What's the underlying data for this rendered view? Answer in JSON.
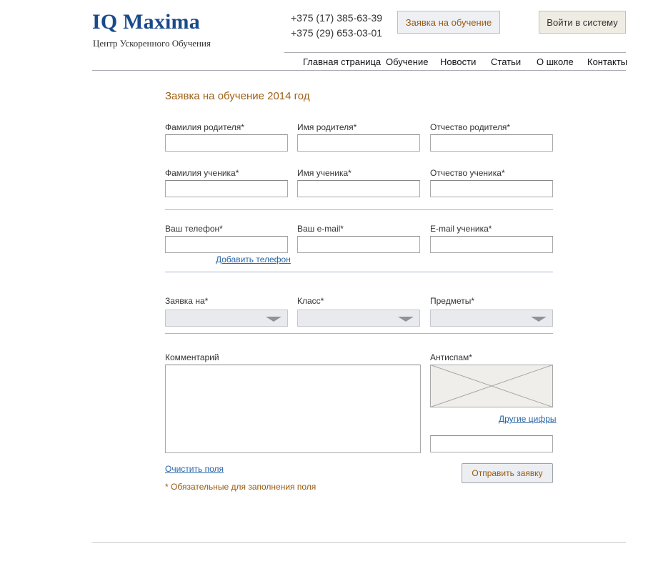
{
  "header": {
    "logo_text": "IQ Maxima",
    "tagline": "Центр Ускоренного Обучения",
    "phones": [
      "+375 (17) 385-63-39",
      "+375 (29) 653-03-01"
    ],
    "apply_button_label": "Заявка на обучение",
    "login_button_label": "Войти в систему"
  },
  "nav": {
    "items": [
      "Главная страница",
      "Обучение",
      "Новости",
      "Статьи",
      "О школе",
      "Контакты"
    ]
  },
  "form": {
    "title": "Заявка на обучение 2014 год",
    "parent_last_name": {
      "label": "Фамилия родителя*",
      "value": ""
    },
    "parent_first_name": {
      "label": "Имя родителя*",
      "value": ""
    },
    "parent_middle_name": {
      "label": "Отчество родителя*",
      "value": ""
    },
    "student_last_name": {
      "label": "Фамилия ученика*",
      "value": ""
    },
    "student_first_name": {
      "label": "Имя ученика*",
      "value": ""
    },
    "student_middle_name": {
      "label": "Отчество ученика*",
      "value": ""
    },
    "phone": {
      "label": "Ваш телефон*",
      "value": ""
    },
    "email": {
      "label": "Ваш e-mail*",
      "value": ""
    },
    "student_email": {
      "label": "E-mail ученика*",
      "value": ""
    },
    "add_phone_link": "Добавить телефон",
    "application_for": {
      "label": "Заявка на*",
      "value": ""
    },
    "grade": {
      "label": "Класс*",
      "value": ""
    },
    "subjects": {
      "label": "Предметы*",
      "value": ""
    },
    "comment": {
      "label": "Комментарий",
      "value": ""
    },
    "antispam": {
      "label": "Антиспам*",
      "value": ""
    },
    "other_digits_link": "Другие цифры",
    "clear_link": "Очистить поля",
    "submit_label": "Отправить заявку",
    "required_note": "* Обязательные для заполнения поля"
  },
  "colors": {
    "logo": "#1a4a8a",
    "accent_orange": "#a06218",
    "link_blue": "#2a66a8",
    "separator_blue": "#a6b8cc",
    "select_bg": "#e9eaee",
    "captcha_bg": "#efeeea"
  }
}
